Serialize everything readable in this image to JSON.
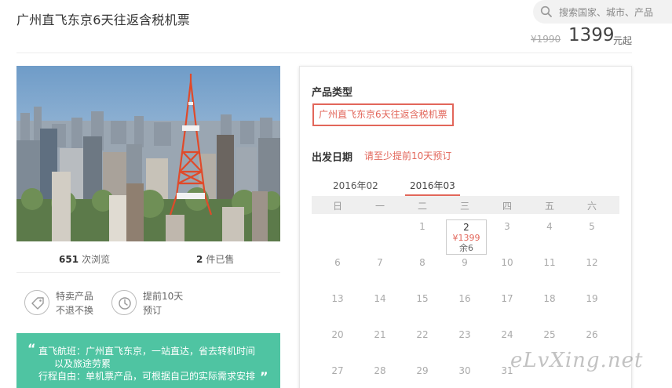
{
  "header": {
    "title": "广州直飞东京6天往返含税机票",
    "search_placeholder": "搜索国家、城市、产品",
    "price_original": "¥1990",
    "price_current": "1399",
    "price_unit": "元起"
  },
  "stats": {
    "views_count": "651",
    "views_label": "次浏览",
    "sold_count": "2",
    "sold_label": "件已售"
  },
  "features": [
    {
      "icon": "tag-icon",
      "line1": "特卖产品",
      "line2": "不退不换"
    },
    {
      "icon": "clock-icon",
      "line1": "提前10天",
      "line2": "预订"
    }
  ],
  "highlights": {
    "line1": "直飞航班：广州直飞东京，一站直达，省去转机时间",
    "line2": "以及旅途劳累",
    "line3": "行程自由：单机票产品，可根据自己的实际需求安排"
  },
  "booking": {
    "product_type_label": "产品类型",
    "product_option": "广州直飞东京6天往返含税机票",
    "departure_label": "出发日期",
    "departure_hint": "请至少提前10天预订",
    "months": [
      "2016年02",
      "2016年03"
    ],
    "selected_month": "2016年03",
    "weekdays": [
      "日",
      "一",
      "二",
      "三",
      "四",
      "五",
      "六"
    ],
    "active_day": {
      "day": "2",
      "price": "¥1399",
      "remaining": "余6"
    },
    "weeks": [
      [
        "",
        "",
        "1",
        "2",
        "3",
        "4",
        "5"
      ],
      [
        "6",
        "7",
        "8",
        "9",
        "10",
        "11",
        "12"
      ],
      [
        "13",
        "14",
        "15",
        "16",
        "17",
        "18",
        "19"
      ],
      [
        "20",
        "21",
        "22",
        "23",
        "24",
        "25",
        "26"
      ],
      [
        "27",
        "28",
        "29",
        "30",
        "31",
        "",
        ""
      ]
    ]
  },
  "watermark": "eLvXing.net",
  "colors": {
    "accent": "#e2665a",
    "highlight_bg": "#4fc4a2"
  }
}
